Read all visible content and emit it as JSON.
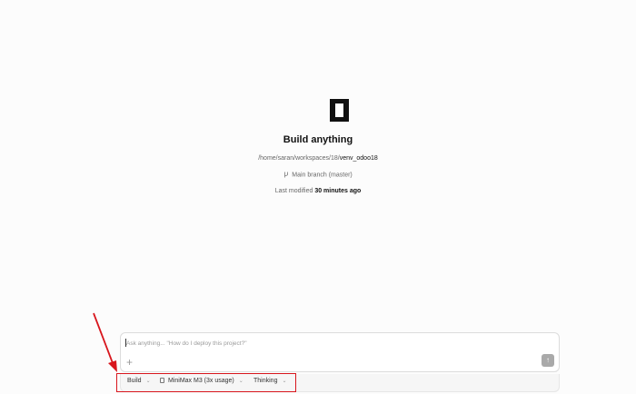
{
  "hero": {
    "title": "Build anything",
    "path_prefix": "/home/saran/workspaces/18/",
    "path_folder": "venv_odoo18",
    "branch": "Main branch (master)",
    "modified_label": "Last modified",
    "modified_value": "30 minutes ago"
  },
  "composer": {
    "placeholder": "Ask anything... \"How do I deploy this project?\"",
    "add_symbol": "+",
    "send_symbol": "↑"
  },
  "toolbar": {
    "mode": "Build",
    "model": "MiniMax M3 (3x usage)",
    "reasoning": "Thinking"
  },
  "colors": {
    "highlight": "#d8161d",
    "background": "#fcfcfc"
  }
}
